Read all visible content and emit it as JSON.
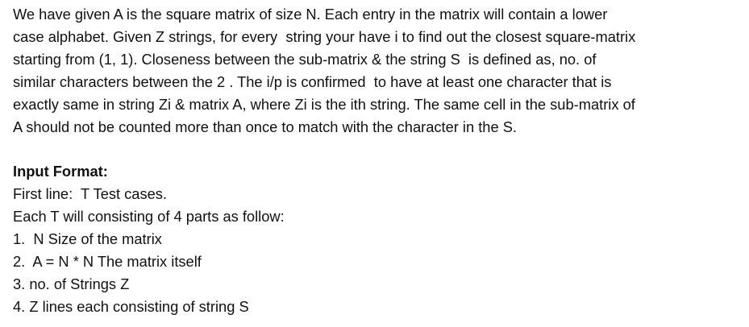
{
  "problem": {
    "paragraph_lines": [
      "We have given A is the square matrix of size N. Each entry in the matrix will contain a lower",
      "case alphabet. Given Z strings, for every  string your have i to find out the closest square-matrix",
      "starting from (1, 1). Closeness between the sub-matrix & the string S  is defined as, no. of",
      "similar characters between the 2 . The i/p is confirmed  to have at least one character that is",
      "exactly same in string Zi & matrix A, where Zi is the ith string. The same cell in the sub-matrix of",
      "A should not be counted more than once to match with the character in the S."
    ],
    "input_format": {
      "heading": "Input Format:",
      "lines": [
        "First line:  T Test cases.",
        "Each T will consisting of 4 parts as follow:",
        "1.  N Size of the matrix",
        "2.  A = N * N The matrix itself",
        "3. no. of Strings Z",
        "4. Z lines each consisting of string S"
      ]
    }
  }
}
